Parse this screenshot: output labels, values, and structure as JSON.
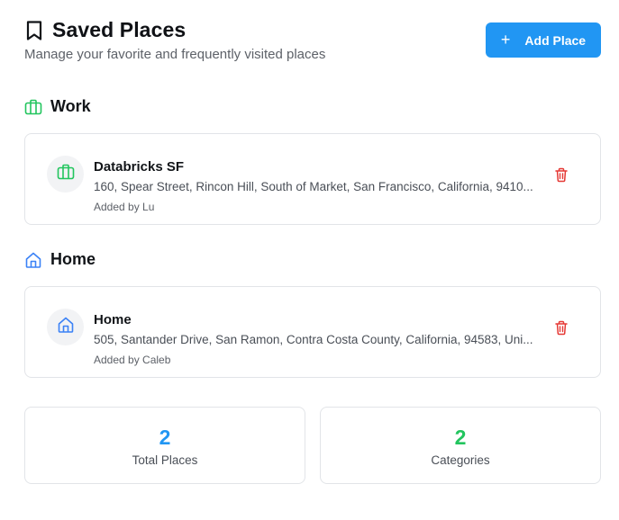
{
  "header": {
    "title": "Saved Places",
    "subtitle": "Manage your favorite and frequently visited places",
    "add_button_label": "Add Place",
    "add_button_icon": "plus"
  },
  "colors": {
    "primary": "#2196f3",
    "work_accent": "#22c55e",
    "home_accent": "#3b82f6",
    "delete": "#e53935"
  },
  "sections": [
    {
      "heading": "Work",
      "icon": "briefcase-icon",
      "places": [
        {
          "name": "Databricks SF",
          "address": "160, Spear Street, Rincon Hill, South of Market, San Francisco, California, 9410...",
          "added_by": "Added by Lu"
        }
      ]
    },
    {
      "heading": "Home",
      "icon": "house-icon",
      "places": [
        {
          "name": "Home",
          "address": "505, Santander Drive, San Ramon, Contra Costa County, California, 94583, Uni...",
          "added_by": "Added by Caleb"
        }
      ]
    }
  ],
  "stats": [
    {
      "value": "2",
      "label": "Total Places",
      "color": "#2196f3"
    },
    {
      "value": "2",
      "label": "Categories",
      "color": "#22c55e"
    }
  ]
}
